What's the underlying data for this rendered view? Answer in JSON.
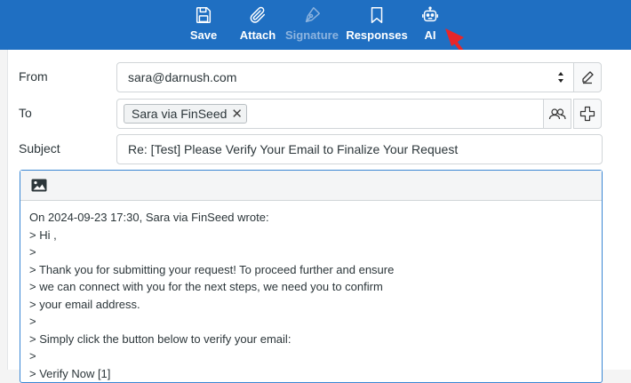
{
  "toolbar": {
    "save": "Save",
    "attach": "Attach",
    "signature": "Signature",
    "responses": "Responses",
    "ai": "AI"
  },
  "form": {
    "from_label": "From",
    "from_value": "sara@darnush.com",
    "to_label": "To",
    "recipient": "Sara via FinSeed",
    "subject_label": "Subject",
    "subject_value": "Re: [Test] Please Verify Your Email to Finalize Your Request"
  },
  "body": {
    "lines": [
      "On 2024-09-23 17:30, Sara via FinSeed wrote:",
      "> Hi ,",
      ">",
      "> Thank you for submitting your request! To proceed further and ensure",
      "> we can connect with you for the next steps, we need you to confirm",
      "> your email address.",
      ">",
      "> Simply click the button below to verify your email:",
      ">",
      "> Verify Now [1]"
    ]
  },
  "colors": {
    "toolbar_bg": "#1f6fc2",
    "annotation_arrow": "#e8262a",
    "editor_focus": "#3b87d4"
  },
  "icons": {
    "save": "floppy-disk-icon",
    "attach": "paperclip-icon",
    "signature": "pen-nib-icon",
    "responses": "bookmark-icon",
    "ai": "robot-icon",
    "from_edit": "pencil-icon",
    "to_contacts": "contacts-icon",
    "to_add": "plus-icon",
    "editor_image": "image-icon"
  }
}
